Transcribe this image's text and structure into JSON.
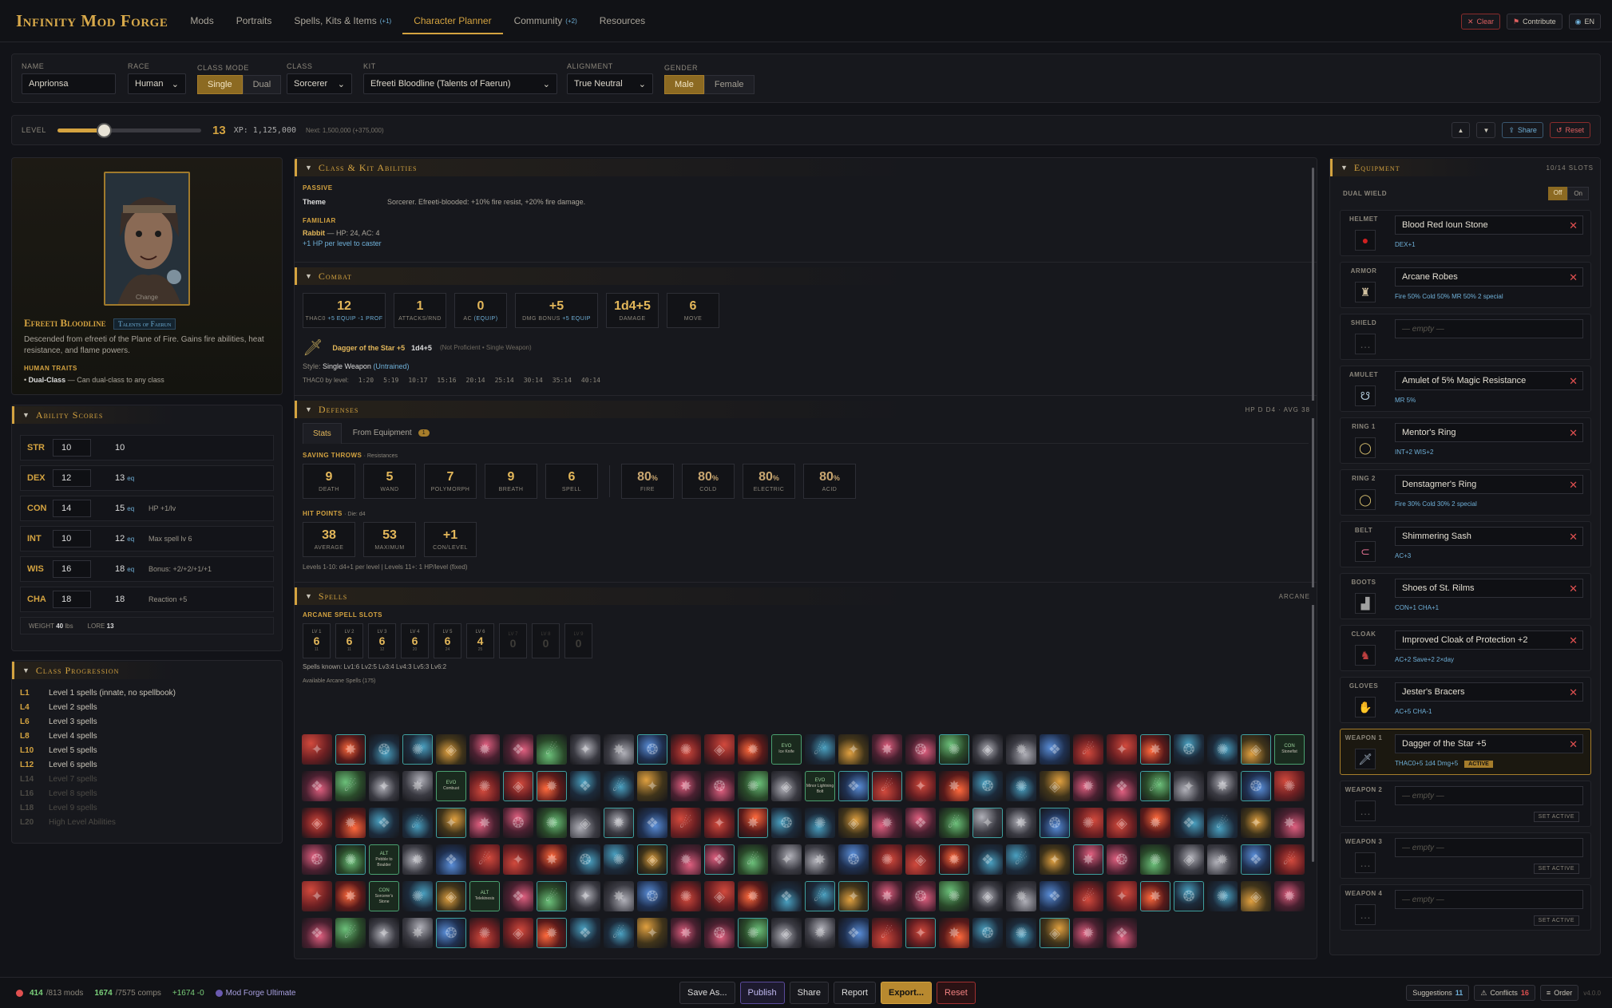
{
  "app": {
    "logo": "Infinity Mod Forge",
    "nav": [
      {
        "label": "Mods",
        "badge": ""
      },
      {
        "label": "Portraits",
        "badge": ""
      },
      {
        "label": "Spells, Kits & Items",
        "badge": "(+1)"
      },
      {
        "label": "Character Planner",
        "badge": ""
      },
      {
        "label": "Community",
        "badge": "(+2)"
      },
      {
        "label": "Resources",
        "badge": ""
      }
    ],
    "active_nav": "Character Planner",
    "clear": "Clear",
    "contribute": "Contribute",
    "lang": "EN"
  },
  "colors": {
    "accent": "#d4a340",
    "info": "#6fb0d8",
    "danger": "#e05050"
  },
  "character": {
    "name_label": "NAME",
    "name": "Anprionsa",
    "race_label": "RACE",
    "race": "Human",
    "classmode_label": "CLASS MODE",
    "classmode": [
      "Single",
      "Dual"
    ],
    "classmode_selected": "Single",
    "class_label": "CLASS",
    "class": "Sorcerer",
    "kit_label": "KIT",
    "kit": "Efreeti Bloodline (Talents of Faerun)",
    "alignment_label": "ALIGNMENT",
    "alignment": "True Neutral",
    "gender_label": "GENDER",
    "gender": [
      "Male",
      "Female"
    ],
    "gender_selected": "Male"
  },
  "level": {
    "label": "LEVEL",
    "value": "13",
    "fraction": 0.32,
    "xp": "XP: 1,125,000",
    "next": "Next: 1,500,000 (+375,000)",
    "up": "▲",
    "down": "▼",
    "share": "Share",
    "reset": "Reset"
  },
  "portrait": {
    "caption": "Change"
  },
  "kit": {
    "name": "Efreeti Bloodline",
    "tag": "Talents of Faerun",
    "desc": "Descended from efreeti of the Plane of Fire. Gains fire abilities, heat resistance, and flame powers.",
    "traits_label": "HUMAN TRAITS",
    "trait_name": "Dual-Class",
    "trait_desc": " — Can dual-class to any class"
  },
  "abilities": {
    "title": "Ability Scores",
    "rows": [
      {
        "name": "STR",
        "base": "10",
        "final": "10",
        "eq": "",
        "note": ""
      },
      {
        "name": "DEX",
        "base": "12",
        "final": "13",
        "eq": "eq",
        "note": ""
      },
      {
        "name": "CON",
        "base": "14",
        "final": "15",
        "eq": "eq",
        "note": "HP +1/lv"
      },
      {
        "name": "INT",
        "base": "10",
        "final": "12",
        "eq": "eq",
        "note": "Max spell lv 6"
      },
      {
        "name": "WIS",
        "base": "16",
        "final": "18",
        "eq": "eq",
        "note": "Bonus: +2/+2/+1/+1"
      },
      {
        "name": "CHA",
        "base": "18",
        "final": "18",
        "eq": "",
        "note": "Reaction +5"
      }
    ],
    "weight_label": "WEIGHT",
    "weight": "40",
    "weight_unit": "lbs",
    "lore_label": "LORE",
    "lore": "13"
  },
  "progression": {
    "title": "Class Progression",
    "rows": [
      {
        "lv": "L1",
        "text": "Level 1 spells (innate, no spellbook)",
        "off": false
      },
      {
        "lv": "L4",
        "text": "Level 2 spells",
        "off": false
      },
      {
        "lv": "L6",
        "text": "Level 3 spells",
        "off": false
      },
      {
        "lv": "L8",
        "text": "Level 4 spells",
        "off": false
      },
      {
        "lv": "L10",
        "text": "Level 5 spells",
        "off": false
      },
      {
        "lv": "L12",
        "text": "Level 6 spells",
        "off": false
      },
      {
        "lv": "L14",
        "text": "Level 7 spells",
        "off": true
      },
      {
        "lv": "L16",
        "text": "Level 8 spells",
        "off": true
      },
      {
        "lv": "L18",
        "text": "Level 9 spells",
        "off": true
      },
      {
        "lv": "L20",
        "text": "High Level Abilities",
        "off": true
      }
    ]
  },
  "class_abilities": {
    "title": "Class & Kit Abilities",
    "passive": "PASSIVE",
    "theme_label": "Theme",
    "theme": "Sorcerer. Efreeti-blooded: +10% fire resist, +20% fire damage.",
    "familiar": "FAMILIAR",
    "familiar_name": "Rabbit",
    "familiar_stats": " — HP: 24, AC: 4",
    "familiar_bonus": "+1 HP per level to caster"
  },
  "combat": {
    "title": "Combat",
    "stats": [
      {
        "v": "12",
        "l": "THAC0",
        "x": "+5 EQUIP -1 PROF"
      },
      {
        "v": "1",
        "l": "ATTACKS/RND",
        "x": ""
      },
      {
        "v": "0",
        "l": "AC",
        "x": "(EQUIP)"
      },
      {
        "v": "+5",
        "l": "DMG BONUS",
        "x": "+5 EQUIP"
      },
      {
        "v": "1d4+5",
        "l": "DAMAGE",
        "x": ""
      },
      {
        "v": "6",
        "l": "MOVE",
        "x": ""
      }
    ],
    "weapon": "Dagger of the Star +5",
    "weapon_dmg": "1d4+5",
    "weapon_note": "(Not Proficient • Single Weapon)",
    "style_label": "Style:",
    "style": "Single Weapon",
    "style_tag": "(Untrained)",
    "thac0_label": "THAC0 by level:",
    "thac0": [
      "1:20",
      "5:19",
      "10:17",
      "15:16",
      "20:14",
      "25:14",
      "30:14",
      "35:14",
      "40:14"
    ]
  },
  "defenses": {
    "title": "Defenses",
    "right": "HP D D4 · AVG 38",
    "tabs": [
      "Stats",
      "From Equipment"
    ],
    "tab_badge": "1",
    "saves_label": "SAVING THROWS",
    "resist_label": "· Resistances",
    "saves": [
      {
        "v": "9",
        "l": "DEATH"
      },
      {
        "v": "5",
        "l": "WAND"
      },
      {
        "v": "7",
        "l": "POLYMORPH"
      },
      {
        "v": "9",
        "l": "BREATH"
      },
      {
        "v": "6",
        "l": "SPELL"
      }
    ],
    "resists": [
      {
        "v": "80",
        "l": "FIRE"
      },
      {
        "v": "80",
        "l": "COLD"
      },
      {
        "v": "80",
        "l": "ELECTRIC"
      },
      {
        "v": "80",
        "l": "ACID"
      }
    ],
    "hp_label": "HIT POINTS",
    "hp_die": "· Die: d4",
    "hp": [
      {
        "v": "38",
        "l": "AVERAGE"
      },
      {
        "v": "53",
        "l": "MAXIMUM"
      },
      {
        "v": "+1",
        "l": "CON/LEVEL"
      }
    ],
    "hp_note": "Levels 1-10: d4+1 per level | Levels 11+: 1 HP/level (fixed)"
  },
  "spells": {
    "title": "Spells",
    "right": "ARCANE",
    "slots_label": "ARCANE SPELL SLOTS",
    "slots": [
      {
        "l": "LV 1",
        "v": "6",
        "s": "11",
        "off": false
      },
      {
        "l": "LV 2",
        "v": "6",
        "s": "11",
        "off": false
      },
      {
        "l": "LV 3",
        "v": "6",
        "s": "12",
        "off": false
      },
      {
        "l": "LV 4",
        "v": "6",
        "s": "20",
        "off": false
      },
      {
        "l": "LV 5",
        "v": "6",
        "s": "24",
        "off": false
      },
      {
        "l": "LV 6",
        "v": "4",
        "s": "25",
        "off": false
      },
      {
        "l": "LV 7",
        "v": "0",
        "s": "",
        "off": true
      },
      {
        "l": "LV 8",
        "v": "0",
        "s": "",
        "off": true
      },
      {
        "l": "LV 9",
        "v": "0",
        "s": "",
        "off": true
      }
    ],
    "known": "Spells known: Lv1:6 Lv2:5 Lv3:4 Lv4:3 Lv5:3 Lv6:2",
    "available": "Available Arcane Spells (175)",
    "labeled": [
      {
        "idx": 14,
        "tag": "EVO",
        "name": "Ice Knife"
      },
      {
        "idx": 29,
        "tag": "CON",
        "name": "Stonefist"
      },
      {
        "idx": 34,
        "tag": "EVO",
        "name": "Combust"
      },
      {
        "idx": 45,
        "tag": "EVO",
        "name": "Minor Lightning Bolt"
      },
      {
        "idx": 92,
        "tag": "ALT",
        "name": "Pebble to Boulder"
      },
      {
        "idx": 122,
        "tag": "CON",
        "name": "Sorcerer's Stone"
      },
      {
        "idx": 125,
        "tag": "ALT",
        "name": "Telekinesis"
      }
    ]
  },
  "equipment": {
    "title": "Equipment",
    "count": "10/14 SLOTS",
    "dual_label": "DUAL WIELD",
    "dual": [
      "Off",
      "On"
    ],
    "set_active": "SET ACTIVE",
    "active_tag": "ACTIVE",
    "empty": "— empty —",
    "slots": [
      {
        "label": "HELMET",
        "item": "Blood Red Ioun Stone",
        "stat": "DEX+1",
        "icon": "ioun-stone-icon"
      },
      {
        "label": "ARMOR",
        "item": "Arcane Robes",
        "stat": "Fire 50% Cold 50% MR 50% 2 special",
        "icon": "robe-icon"
      },
      {
        "label": "SHIELD",
        "item": "",
        "stat": "",
        "icon": "empty-slot-icon"
      },
      {
        "label": "AMULET",
        "item": "Amulet of 5% Magic Resistance",
        "stat": "MR 5%",
        "icon": "amulet-icon"
      },
      {
        "label": "RING 1",
        "item": "Mentor's Ring",
        "stat": "INT+2 WIS+2",
        "icon": "ring-icon"
      },
      {
        "label": "RING 2",
        "item": "Denstagmer's Ring",
        "stat": "Fire 30% Cold 30% 2 special",
        "icon": "ring-icon"
      },
      {
        "label": "BELT",
        "item": "Shimmering Sash",
        "stat": "AC+3",
        "icon": "belt-icon"
      },
      {
        "label": "BOOTS",
        "item": "Shoes of St. Rilms",
        "stat": "CON+1 CHA+1",
        "icon": "boots-icon"
      },
      {
        "label": "CLOAK",
        "item": "Improved Cloak of Protection +2",
        "stat": "AC+2 Save+2 2×day",
        "icon": "cloak-icon"
      },
      {
        "label": "GLOVES",
        "item": "Jester's Bracers",
        "stat": "AC+5 CHA-1",
        "icon": "bracers-icon"
      },
      {
        "label": "WEAPON 1",
        "item": "Dagger of the Star +5",
        "stat": "THAC0+5 1d4 Dmg+5",
        "icon": "dagger-icon",
        "active": true
      },
      {
        "label": "WEAPON 2",
        "item": "",
        "stat": "",
        "icon": "empty-slot-icon"
      },
      {
        "label": "WEAPON 3",
        "item": "",
        "stat": "",
        "icon": "empty-slot-icon"
      },
      {
        "label": "WEAPON 4",
        "item": "",
        "stat": "",
        "icon": "empty-slot-icon"
      }
    ]
  },
  "footer": {
    "mods": "414",
    "mods_total": "/813 mods",
    "comps": "1674",
    "comps_total": "/7575 comps",
    "delta": "+1674 -0",
    "profile": "Mod Forge Ultimate",
    "save_as": "Save As...",
    "publish": "Publish",
    "share": "Share",
    "report": "Report",
    "export": "Export...",
    "reset": "Reset",
    "suggestions": "Suggestions",
    "suggestions_n": "11",
    "conflicts": "Conflicts",
    "conflicts_n": "16",
    "order": "Order",
    "version": "v4.0.0"
  }
}
